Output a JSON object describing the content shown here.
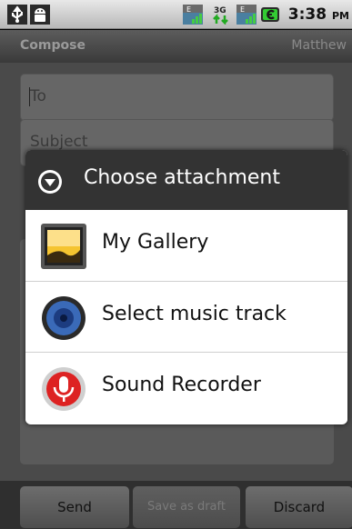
{
  "status_bar": {
    "time": "3:38",
    "ampm": "PM",
    "icons": [
      "usb-icon",
      "android-debug-icon",
      "signal-edge-icon",
      "data-3g-icon",
      "signal-edge-icon",
      "battery-charging-icon"
    ],
    "network_labels": {
      "edge1": "E",
      "g3": "3G",
      "edge2": "E"
    }
  },
  "title_bar": {
    "title": "Compose",
    "account": "Matthew"
  },
  "compose": {
    "to_placeholder": "To",
    "subject_placeholder": "Subject"
  },
  "buttons": {
    "send": "Send",
    "save_draft": "Save as draft",
    "discard": "Discard"
  },
  "dialog": {
    "title": "Choose attachment",
    "options": [
      {
        "label": "My Gallery",
        "icon": "gallery-icon"
      },
      {
        "label": "Select music track",
        "icon": "music-track-icon"
      },
      {
        "label": "Sound Recorder",
        "icon": "sound-recorder-icon"
      }
    ]
  },
  "colors": {
    "dialog_header": "#333333",
    "battery_green": "#33cc33",
    "overlay": "#4a4a4a"
  }
}
